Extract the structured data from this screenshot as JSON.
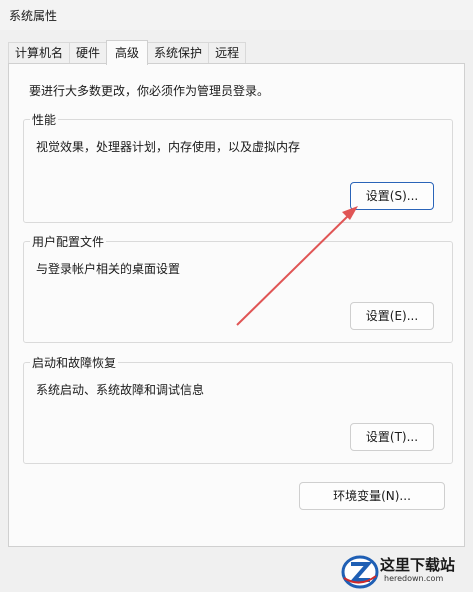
{
  "window": {
    "title": "系统属性"
  },
  "tabs": [
    {
      "label": "计算机名",
      "active": false
    },
    {
      "label": "硬件",
      "active": false
    },
    {
      "label": "高级",
      "active": true
    },
    {
      "label": "系统保护",
      "active": false
    },
    {
      "label": "远程",
      "active": false
    }
  ],
  "admin_note": "要进行大多数更改，你必须作为管理员登录。",
  "performance": {
    "title": "性能",
    "description": "视觉效果，处理器计划，内存使用，以及虚拟内存",
    "button": "设置(S)..."
  },
  "user_profiles": {
    "title": "用户配置文件",
    "description": "与登录帐户相关的桌面设置",
    "button": "设置(E)..."
  },
  "startup_recovery": {
    "title": "启动和故障恢复",
    "description": "系统启动、系统故障和调试信息",
    "button": "设置(T)..."
  },
  "env_button": "环境变量(N)...",
  "watermark": {
    "name": "这里下载站",
    "url": "heredown.com"
  },
  "colors": {
    "accent": "#2a64b8",
    "annotation_arrow": "#e05555"
  }
}
